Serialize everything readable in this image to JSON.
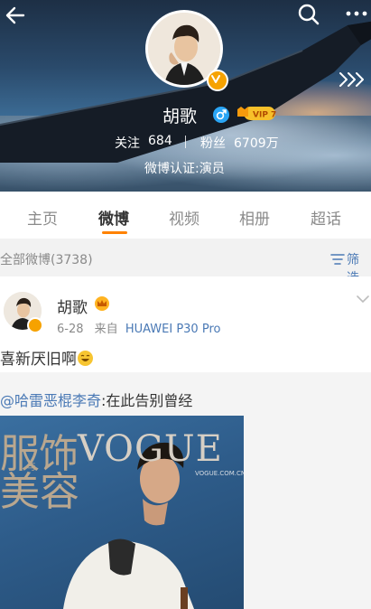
{
  "profile": {
    "name": "胡歌",
    "gender_icon": "male-icon",
    "vip_label": "VIP 7",
    "follow_label": "关注",
    "follow_count": "684",
    "fans_label": "粉丝",
    "fans_count": "6709万",
    "verify_text": "微博认证:演员"
  },
  "tabs": [
    "主页",
    "微博",
    "视频",
    "相册",
    "超话"
  ],
  "filter_bar": {
    "count": "全部微博(3738)",
    "filter_label": "筛选"
  },
  "post": {
    "author": "胡歌",
    "date": "6-28",
    "source_prefix": "来自",
    "source": "HUAWEI P30 Pro",
    "text": "喜新厌旧啊",
    "repost": {
      "mention": "@哈雷恶棍李奇",
      "text": ":在此告别曾经",
      "cover_title_cn_1": "服饰",
      "cover_title_cn_2": "美容",
      "cover_title_latin": "VOGUE",
      "cover_small": "与",
      "cover_sub": "VOGUE.COM.CN"
    }
  },
  "colors": {
    "accent": "#ff8200",
    "link": "#4a79b5",
    "verified": "#f6a200",
    "male": "#2aa5f5"
  }
}
